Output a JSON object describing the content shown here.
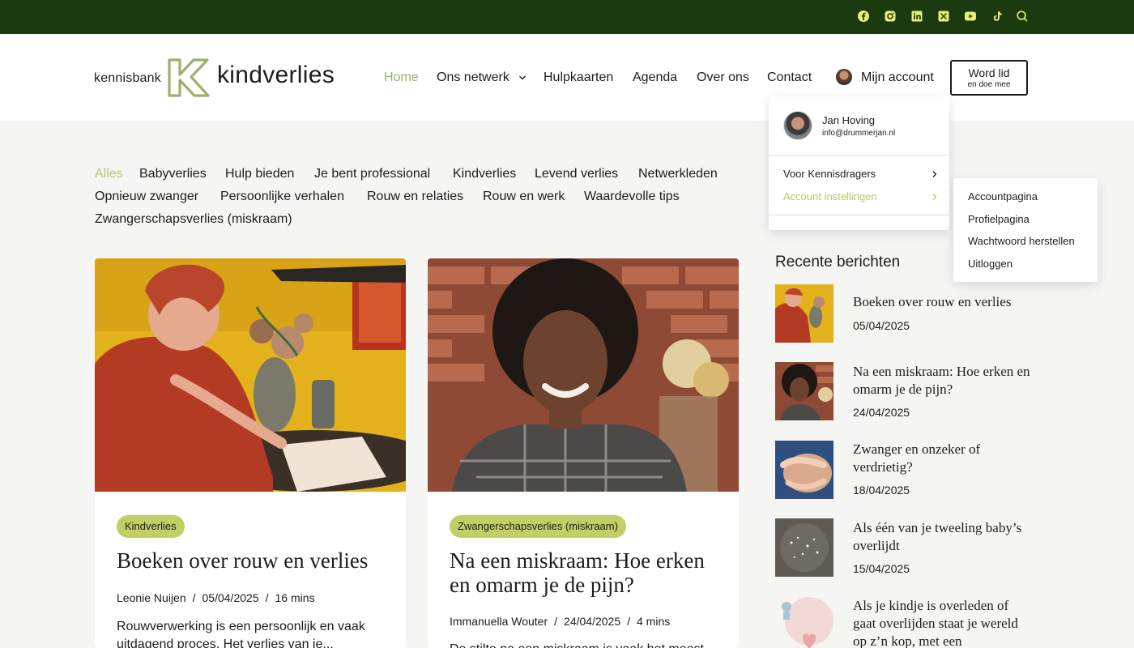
{
  "colors": {
    "topbar": "#1b3a10",
    "accent": "#9bb06a",
    "tag": "#c2cf66",
    "social_icon": "#e8f07a"
  },
  "topbar": {
    "icons": [
      "facebook-icon",
      "instagram-icon",
      "linkedin-icon",
      "x-icon",
      "youtube-icon",
      "tiktok-icon",
      "search-icon"
    ]
  },
  "brand": {
    "small": "kennisbank",
    "big": "kindverlies"
  },
  "nav": {
    "home": "Home",
    "netwerk": "Ons netwerk",
    "hulpkaarten": "Hulpkaarten",
    "agenda": "Agenda",
    "over": "Over ons",
    "contact": "Contact",
    "account": "Mijn account",
    "word_lid": "Word lid",
    "word_lid_sub": "en doe mee"
  },
  "categories": [
    "Alles",
    "Babyverlies",
    "Hulp bieden",
    "Je bent professional",
    "Kindverlies",
    "Levend verlies",
    "Netwerkleden",
    "Opnieuw zwanger",
    "Persoonlijke verhalen",
    "Rouw en relaties",
    "Rouw en werk",
    "Waardevolle tips",
    "Zwangerschapsverlies (miskraam)"
  ],
  "posts": [
    {
      "tag": "Kindverlies",
      "title": "Boeken over rouw en verlies",
      "author": "Leonie Nuijen",
      "date": "05/04/2025",
      "read": "16 mins",
      "excerpt": "Rouwverwerking is een persoonlijk en vaak uitdagend proces. Het verlies van je..."
    },
    {
      "tag": "Zwangerschapsverlies (miskraam)",
      "title": "Na een miskraam: Hoe erken en omarm je de pijn?",
      "author": "Immanuella Wouter",
      "date": "24/04/2025",
      "read": "4 mins",
      "excerpt": "De stilte na een miskraam is vaak het meest"
    }
  ],
  "sidebar": {
    "title": "Recente berichten",
    "items": [
      {
        "title": "Boeken over rouw en verlies",
        "date": "05/04/2025"
      },
      {
        "title": "Na een miskraam: Hoe erken en omarm je de pijn?",
        "date": "24/04/2025"
      },
      {
        "title": "Zwanger en onzeker of verdrietig?",
        "date": "18/04/2025"
      },
      {
        "title": "Als één van je tweeling baby’s overlijdt",
        "date": "15/04/2025"
      },
      {
        "title": "Als je kindje is overleden of gaat overlijden staat je wereld op z’n kop, met een",
        "date": ""
      }
    ]
  },
  "account_menu": {
    "name": "Jan Hoving",
    "email": "info@drummerjan.nl",
    "items": [
      "Voor Kennisdragers",
      "Account instellingen"
    ],
    "submenu": [
      "Accountpagina",
      "Profielpagina",
      "Wachtwoord herstellen",
      "Uitloggen"
    ]
  }
}
